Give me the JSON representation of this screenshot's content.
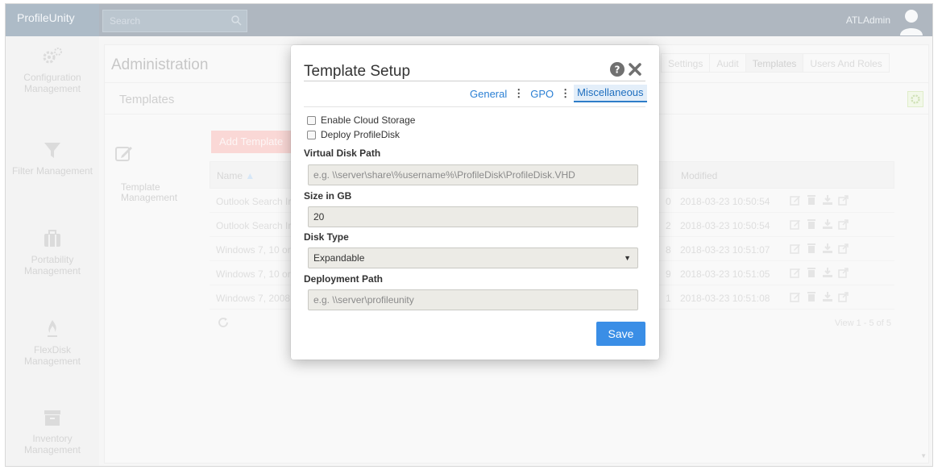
{
  "app": {
    "title": "ProfileUnity"
  },
  "search": {
    "placeholder": "Search",
    "icon": "search-icon"
  },
  "user": {
    "name": "ATLAdmin",
    "icon": "user-avatar-icon"
  },
  "sidebar": {
    "items": [
      {
        "label": "Configuration Management",
        "icon": "gears-icon"
      },
      {
        "label": "Filter Management",
        "icon": "filter-icon"
      },
      {
        "label": "Portability Management",
        "icon": "briefcase-icon"
      },
      {
        "label": "FlexDisk Management",
        "icon": "flame-icon"
      },
      {
        "label": "Inventory Management",
        "icon": "archive-icon"
      }
    ]
  },
  "main": {
    "title": "Administration",
    "tabs": [
      "Settings",
      "Audit",
      "Templates",
      "Users And Roles"
    ],
    "active_tab": "Templates",
    "section_title": "Templates",
    "side_label": "Template Management",
    "add_button": "Add Template",
    "grid": {
      "columns": {
        "name": "Name",
        "modified": "Modified"
      },
      "rows": [
        {
          "name": "Outlook Search Ir",
          "num": "0",
          "modified": "2018-03-23 10:50:54"
        },
        {
          "name": "Outlook Search Ir",
          "num": "2",
          "modified": "2018-03-23 10:50:54"
        },
        {
          "name": "Windows 7, 10 or",
          "num": "8",
          "modified": "2018-03-23 10:51:07"
        },
        {
          "name": "Windows 7, 10 or",
          "num": "9",
          "modified": "2018-03-23 10:51:05"
        },
        {
          "name": "Windows 7, 2008",
          "num": "1",
          "modified": "2018-03-23 10:51:08"
        }
      ],
      "pager": "View 1 - 5 of 5"
    }
  },
  "modal": {
    "title": "Template Setup",
    "tabs": [
      "General",
      "GPO",
      "Miscellaneous"
    ],
    "active_tab": "Miscellaneous",
    "checkboxes": [
      {
        "label": "Enable Cloud Storage",
        "checked": false
      },
      {
        "label": "Deploy ProfileDisk",
        "checked": false
      }
    ],
    "fields": {
      "virtual_disk_path": {
        "label": "Virtual Disk Path",
        "placeholder": "e.g. \\\\server\\share\\%username%\\ProfileDisk\\ProfileDisk.VHD",
        "value": ""
      },
      "size_gb": {
        "label": "Size in GB",
        "value": "20"
      },
      "disk_type": {
        "label": "Disk Type",
        "value": "Expandable"
      },
      "deployment_path": {
        "label": "Deployment Path",
        "placeholder": "e.g. \\\\server\\profileunity",
        "value": ""
      }
    },
    "save_label": "Save"
  },
  "colors": {
    "accent": "#3a8ee6",
    "topbar": "#6d7d8c",
    "add_button": "#f6b8b4"
  }
}
